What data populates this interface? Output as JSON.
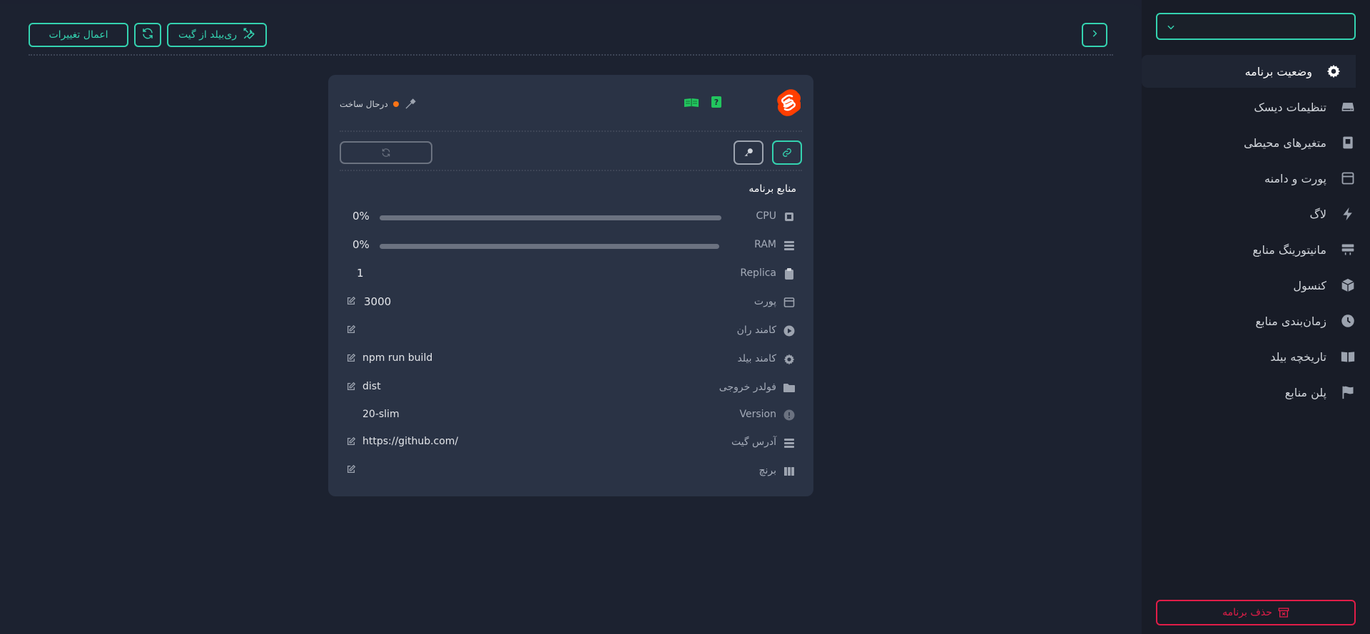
{
  "topbar": {
    "apply_label": "اعمال تغییرات",
    "rebuild_label": "ری‌بیلد از گیت"
  },
  "card": {
    "status_text": "درحال ساخت",
    "resources_title": "منابع برنامه",
    "rows": {
      "cpu": {
        "label": "CPU",
        "value": "0%",
        "progress": 0
      },
      "ram": {
        "label": "RAM",
        "value": "0%",
        "progress": 0
      },
      "replica": {
        "label": "Replica",
        "value": "1"
      },
      "port": {
        "label": "پورت",
        "value": "3000"
      },
      "run_cmd": {
        "label": "کامند ران",
        "value": ""
      },
      "build_cmd": {
        "label": "کامند بیلد",
        "value": "npm run build"
      },
      "output_dir": {
        "label": "فولدر خروجی",
        "value": "dist"
      },
      "version": {
        "label": "Version",
        "value": "20-slim"
      },
      "git_url": {
        "label": "آدرس گیت",
        "value": "https://github.com/"
      },
      "branch": {
        "label": "برنچ",
        "value": ""
      }
    }
  },
  "sidebar": {
    "items": [
      {
        "label": "وضعیت برنامه",
        "icon": "gear-icon"
      },
      {
        "label": "تنظیمات دیسک",
        "icon": "disk-icon"
      },
      {
        "label": "متغیرهای محیطی",
        "icon": "env-icon"
      },
      {
        "label": "پورت و دامنه",
        "icon": "window-icon"
      },
      {
        "label": "لاگ",
        "icon": "bolt-icon"
      },
      {
        "label": "مانیتورینگ منابع",
        "icon": "monitor-icon"
      },
      {
        "label": "کنسول",
        "icon": "cube-icon"
      },
      {
        "label": "زمان‌بندی منابع",
        "icon": "clock-icon"
      },
      {
        "label": "تاریخچه بیلد",
        "icon": "book-icon"
      },
      {
        "label": "پلن منابع",
        "icon": "flag-icon"
      }
    ],
    "delete_label": "حذف برنامه"
  },
  "colors": {
    "accent": "#34d3b0",
    "danger": "#e11d48",
    "status_dot": "#f97316",
    "svelte": "#ff3e00"
  }
}
